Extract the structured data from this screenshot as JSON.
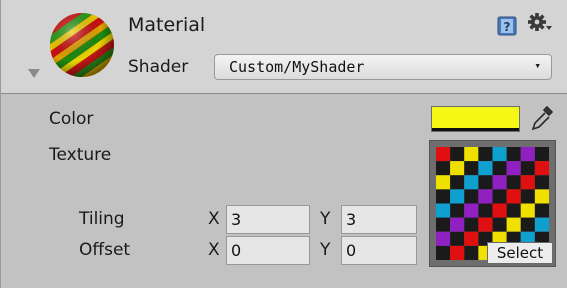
{
  "material": {
    "title": "Material",
    "shader_label": "Shader",
    "shader_value": "Custom/MyShader",
    "dropdown_caret": "▾"
  },
  "properties": {
    "color_label": "Color",
    "color_value": "#f4f814",
    "texture_label": "Texture",
    "select_label": "Select",
    "tiling_label": "Tiling",
    "offset_label": "Offset",
    "tiling": {
      "x_label": "X",
      "x": "3",
      "y_label": "Y",
      "y": "3"
    },
    "offset": {
      "x_label": "X",
      "x": "0",
      "y_label": "Y",
      "y": "0"
    }
  },
  "icons": [
    "sphere-preview",
    "foldout-arrow-icon",
    "help-book-icon",
    "gear-icon",
    "eyedropper-icon"
  ]
}
